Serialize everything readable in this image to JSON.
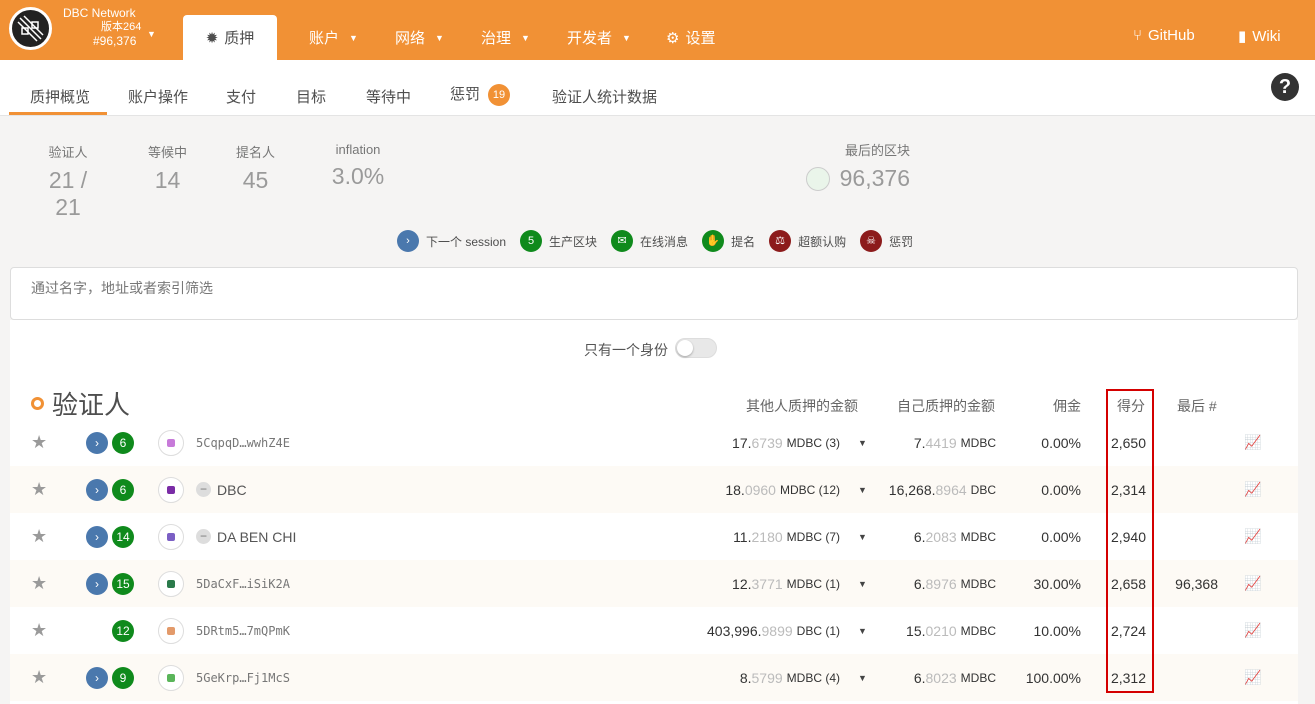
{
  "header": {
    "network_name": "DBC Network",
    "version": "版本264",
    "block": "#96,376",
    "active_tab": "质押",
    "nav": [
      {
        "label": "账户",
        "icon": "caret-down-icon"
      },
      {
        "label": "网络",
        "icon": "caret-down-icon"
      },
      {
        "label": "治理",
        "icon": "caret-down-icon"
      },
      {
        "label": "开发者",
        "icon": "caret-down-icon"
      },
      {
        "label": "设置",
        "icon": "gears-icon"
      }
    ],
    "github": "GitHub",
    "wiki": "Wiki"
  },
  "subnav": {
    "tabs": [
      "质押概览",
      "账户操作",
      "支付",
      "目标",
      "等待中",
      "惩罚",
      "验证人统计数据"
    ],
    "slash_count": "19"
  },
  "summary": {
    "validators_label": "验证人",
    "validators_value": "21 / 21",
    "waiting_label": "等候中",
    "waiting_value": "14",
    "nominators_label": "提名人",
    "nominators_value": "45",
    "inflation_label": "inflation",
    "inflation_value": "3.0%",
    "last_block_label": "最后的区块",
    "last_block_value": "96,376"
  },
  "legend": [
    {
      "label": "下一个 session",
      "glyph": "›",
      "color": "#4a78ad"
    },
    {
      "label": "生产区块",
      "glyph": "5",
      "color": "#0f8a1c"
    },
    {
      "label": "在线消息",
      "glyph": "✉",
      "color": "#0f8a1c"
    },
    {
      "label": "提名",
      "glyph": "✋",
      "color": "#0f8a1c"
    },
    {
      "label": "超额认购",
      "glyph": "⚖",
      "color": "#8c1b1b"
    },
    {
      "label": "惩罚",
      "glyph": "☠",
      "color": "#8c1b1b"
    }
  ],
  "filter": {
    "placeholder": "通过名字，地址或者索引筛选"
  },
  "toggle_label": "只有一个身份",
  "section_title": "验证人",
  "columns": {
    "other_stake": "其他人质押的金额",
    "own_stake": "自己质押的金额",
    "commission": "佣金",
    "points": "得分",
    "last": "最后 #"
  },
  "rows": [
    {
      "next": true,
      "blocks": "6",
      "avatar_color": "#c77ad9",
      "name_type": "addr",
      "name": "5CqpqD…wwhZ4E",
      "other_int": "17.",
      "other_frac": "6739",
      "other_unit": "MDBC (3)",
      "own_int": "7.",
      "own_frac": "4419",
      "own_unit": "MDBC",
      "commission": "0.00%",
      "points": "2,650",
      "last": ""
    },
    {
      "next": true,
      "blocks": "6",
      "avatar_color": "#7a2ca6",
      "name_type": "identity",
      "name": "DBC",
      "other_int": "18.",
      "other_frac": "0960",
      "other_unit": "MDBC (12)",
      "own_int": "16,268.",
      "own_frac": "8964",
      "own_unit": "DBC",
      "commission": "0.00%",
      "points": "2,314",
      "last": ""
    },
    {
      "next": true,
      "blocks": "14",
      "avatar_color": "#7b5fc4",
      "name_type": "identity",
      "name": "DA BEN CHI",
      "other_int": "11.",
      "other_frac": "2180",
      "other_unit": "MDBC (7)",
      "own_int": "6.",
      "own_frac": "2083",
      "own_unit": "MDBC",
      "commission": "0.00%",
      "points": "2,940",
      "last": ""
    },
    {
      "next": true,
      "blocks": "15",
      "avatar_color": "#2a7a4a",
      "name_type": "addr",
      "name": "5DaCxF…iSiK2A",
      "other_int": "12.",
      "other_frac": "3771",
      "other_unit": "MDBC (1)",
      "own_int": "6.",
      "own_frac": "8976",
      "own_unit": "MDBC",
      "commission": "30.00%",
      "points": "2,658",
      "last": "96,368"
    },
    {
      "next": false,
      "blocks": "12",
      "avatar_color": "#e39a6a",
      "name_type": "addr",
      "name": "5DRtm5…7mQPmK",
      "other_int": "403,996.",
      "other_frac": "9899",
      "other_unit": "DBC (1)",
      "own_int": "15.",
      "own_frac": "0210",
      "own_unit": "MDBC",
      "commission": "10.00%",
      "points": "2,724",
      "last": ""
    },
    {
      "next": true,
      "blocks": "9",
      "avatar_color": "#5ab55a",
      "name_type": "addr",
      "name": "5GeKrp…Fj1McS",
      "other_int": "8.",
      "other_frac": "5799",
      "other_unit": "MDBC (4)",
      "own_int": "6.",
      "own_frac": "8023",
      "own_unit": "MDBC",
      "commission": "100.00%",
      "points": "2,312",
      "last": ""
    }
  ]
}
